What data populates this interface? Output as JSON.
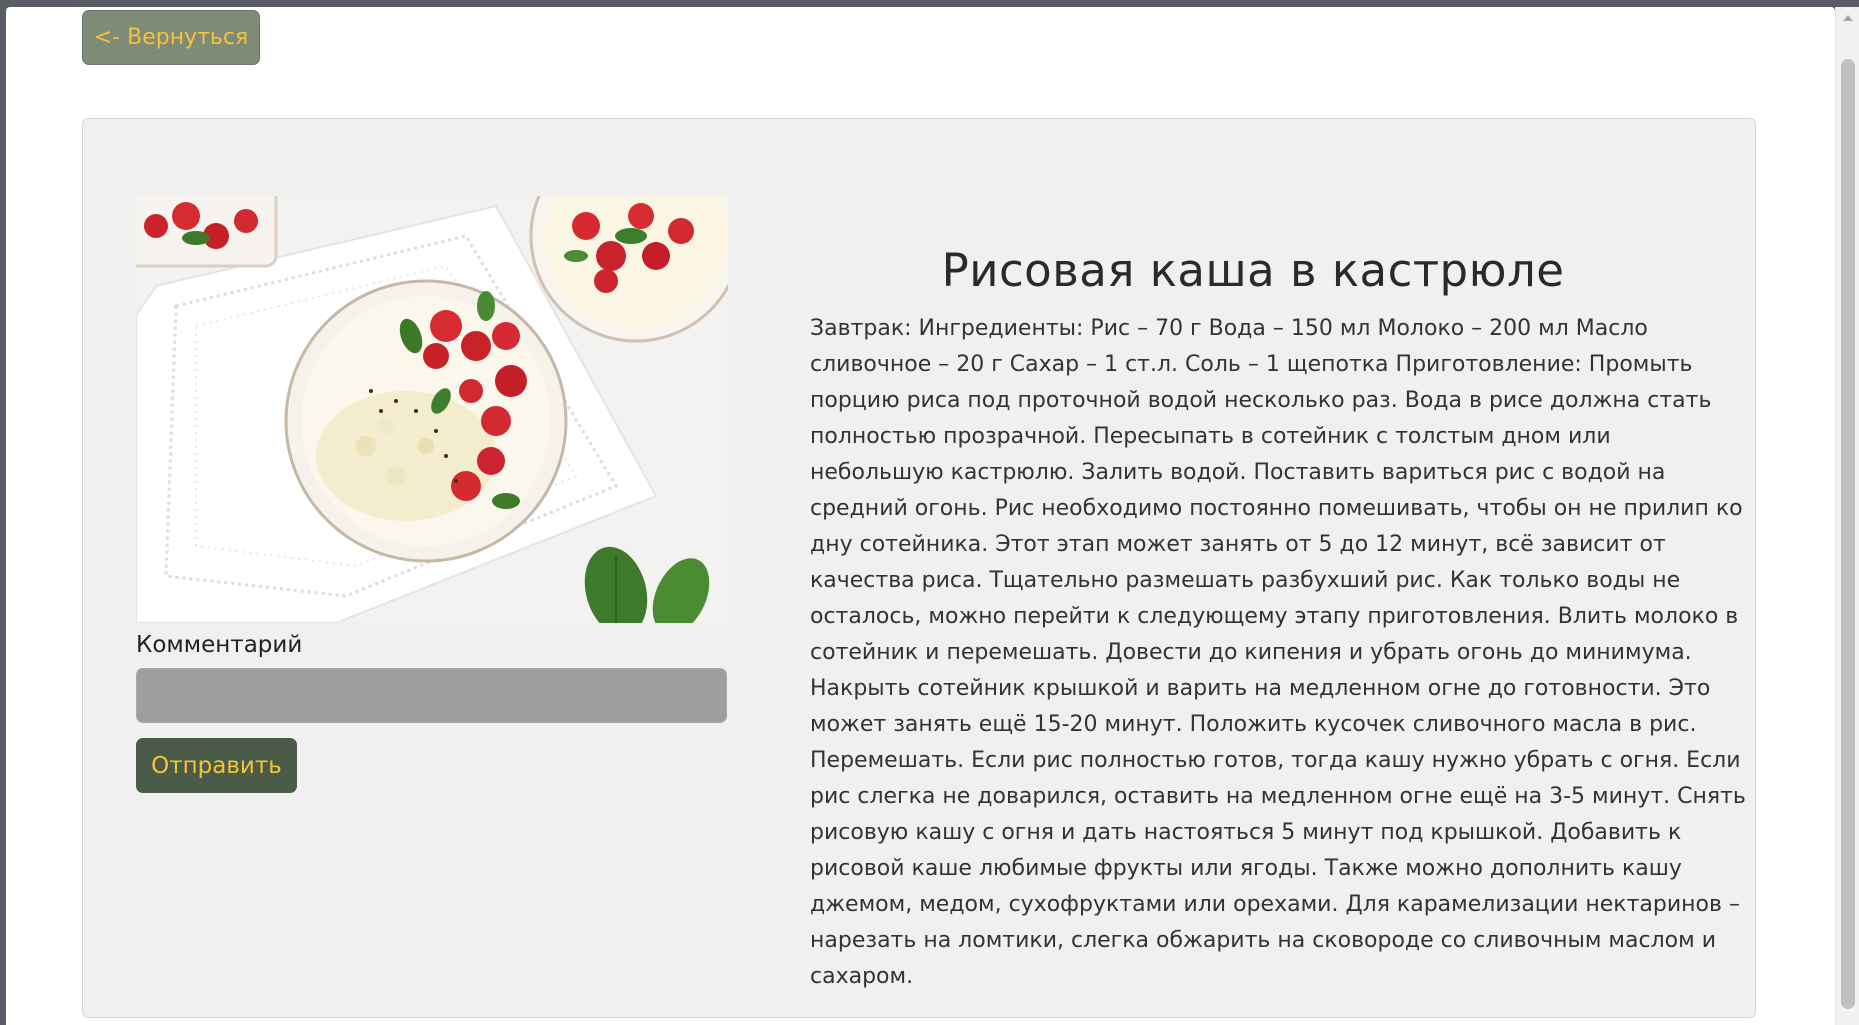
{
  "nav": {
    "back_label": "<- Вернуться"
  },
  "recipe": {
    "title": "Рисовая каша в кастрюле",
    "text": "Завтрак: Ингредиенты: Рис – 70 г Вода – 150 мл Молоко – 200 мл Масло сливочное – 20 г Сахар – 1 ст.л. Соль – 1 щепотка Приготовление: Промыть порцию риса под проточной водой несколько раз. Вода в рисе должна стать полностью прозрачной. Пересыпать в сотейник с толстым дном или небольшую кастрюлю. Залить водой. Поставить вариться рис с водой на средний огонь. Рис необходимо постоянно помешивать, чтобы он не прилип ко дну сотейника. Этот этап может занять от 5 до 12 минут, всё зависит от качества риса. Тщательно размешать разбухший рис. Как только воды не осталось, можно перейти к следующему этапу приготовления. Влить молоко в сотейник и перемешать. Довести до кипения и убрать огонь до минимума. Накрыть сотейник крышкой и варить на медленном огне до готовности. Это может занять ещё 15-20 минут. Положить кусочек сливочного масла в рис. Перемешать. Если рис полностью готов, тогда кашу нужно убрать с огня. Если рис слегка не доварился, оставить на медленном огне ещё на 3-5 минут. Снять рисовую кашу с огня и дать настояться 5 минут под крышкой. Добавить к рисовой каше любимые фрукты или ягоды. Также можно дополнить кашу джемом, медом, сухофруктами или орехами. Для карамелизации нектаринов – нарезать на ломтики, слегка обжарить на сковороде со сливочным маслом и сахаром."
  },
  "comment": {
    "label": "Комментарий",
    "value": "",
    "placeholder": "",
    "submit_label": "Отправить"
  },
  "colors": {
    "back_button_bg": "#7d8b77",
    "submit_button_bg": "#4a5c47",
    "button_text": "#f5c23a",
    "card_bg": "#f0f0f0",
    "input_bg": "#9e9e9e"
  }
}
